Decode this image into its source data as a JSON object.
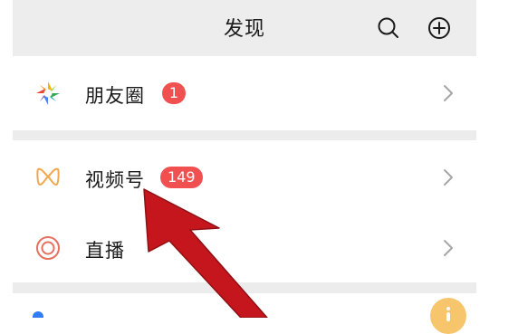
{
  "header": {
    "title": "发现",
    "search_icon": "search-icon",
    "add_icon": "add-circle-icon"
  },
  "items": [
    {
      "label": "朋友圈",
      "icon": "moments-aperture-icon",
      "badge": "1",
      "chevron_icon": "chevron-right-icon"
    },
    {
      "label": "视频号",
      "icon": "channels-butterfly-icon",
      "badge": "149",
      "chevron_icon": "chevron-right-icon"
    },
    {
      "label": "直播",
      "icon": "live-ring-icon",
      "chevron_icon": "chevron-right-icon"
    }
  ],
  "annotation": {
    "icon": "red-arrow-pointer"
  },
  "colors": {
    "header_bg": "#ededed",
    "badge_red": "#f15050",
    "annotation_arrow": "#c4161c",
    "channels_icon": "#f1a84c",
    "live_icon": "#e86f5e",
    "hint_bubble": "#f6c56c"
  }
}
